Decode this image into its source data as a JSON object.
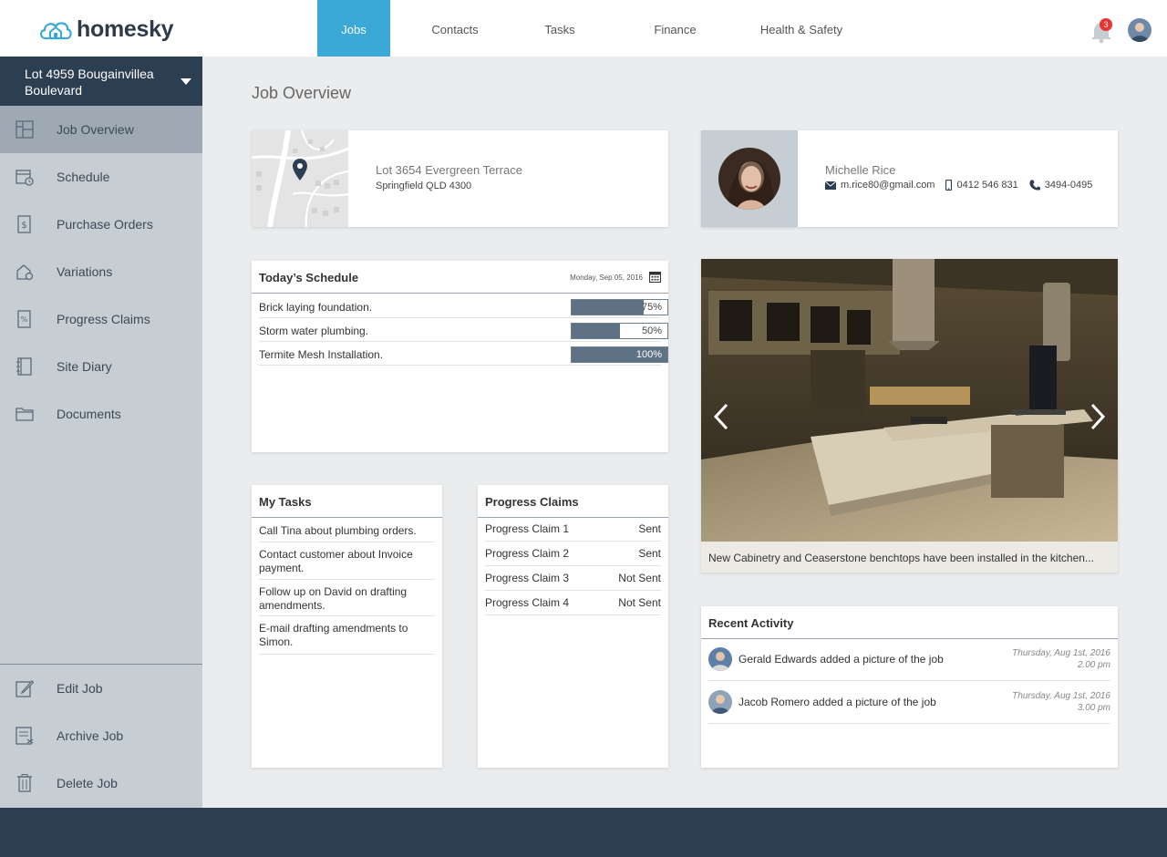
{
  "brand": {
    "name": "homesky",
    "accent": "#3aa9d8",
    "dark": "#2c3e52"
  },
  "nav": {
    "items": [
      {
        "label": "Jobs",
        "active": true
      },
      {
        "label": "Contacts",
        "active": false
      },
      {
        "label": "Tasks",
        "active": false
      },
      {
        "label": "Finance",
        "active": false
      },
      {
        "label": "Health & Safety",
        "active": false
      }
    ],
    "notifications": "3"
  },
  "sidebar": {
    "job_selector": "Lot 4959 Bougainvillea Boulevard",
    "items": [
      {
        "label": "Job Overview",
        "icon": "grid-icon",
        "active": true
      },
      {
        "label": "Schedule",
        "icon": "schedule-icon"
      },
      {
        "label": "Purchase Orders",
        "icon": "purchase-order-icon"
      },
      {
        "label": "Variations",
        "icon": "variations-icon"
      },
      {
        "label": "Progress Claims",
        "icon": "progress-claims-icon"
      },
      {
        "label": "Site Diary",
        "icon": "diary-icon"
      },
      {
        "label": "Documents",
        "icon": "folder-icon"
      }
    ],
    "actions": [
      {
        "label": "Edit Job",
        "icon": "edit-icon"
      },
      {
        "label": "Archive Job",
        "icon": "archive-icon"
      },
      {
        "label": "Delete Job",
        "icon": "trash-icon"
      }
    ]
  },
  "main": {
    "title": "Job Overview",
    "address": {
      "line1": "Lot 3654 Evergreen Terrace",
      "line2": "Springfield QLD 4300"
    },
    "contact": {
      "name": "Michelle Rice",
      "email": "m.rice80@gmail.com",
      "mobile": "0412 546 831",
      "phone": "3494-0495"
    },
    "schedule": {
      "title": "Today’s Schedule",
      "date": "Monday, Sep 05, 2016",
      "rows": [
        {
          "label": "Brick laying foundation.",
          "pct_text": "75%",
          "progress": 0.75
        },
        {
          "label": "Storm water plumbing.",
          "pct_text": "50%",
          "progress": 0.5
        },
        {
          "label": "Termite Mesh Installation.",
          "pct_text": "100%",
          "progress": 1.0
        }
      ]
    },
    "tasks": {
      "title": "My Tasks",
      "items": [
        "Call Tina about plumbing orders.",
        "Contact customer about Invoice payment.",
        "Follow up on David on drafting amendments.",
        "E-mail drafting amendments to Simon."
      ]
    },
    "claims": {
      "title": "Progress Claims",
      "rows": [
        {
          "name": "Progress Claim 1",
          "status": "Sent"
        },
        {
          "name": "Progress Claim 2",
          "status": "Sent"
        },
        {
          "name": "Progress Claim 3",
          "status": "Not Sent"
        },
        {
          "name": "Progress Claim 4",
          "status": "Not Sent"
        }
      ]
    },
    "photo": {
      "caption": "New Cabinetry and Ceaserstone benchtops have been installed in the kitchen..."
    },
    "activity": {
      "title": "Recent Activity",
      "rows": [
        {
          "text": "Gerald Edwards added a picture of the job",
          "date": "Thursday, Aug 1st, 2016",
          "time": "2.00 pm"
        },
        {
          "text": "Jacob Romero added a picture of the job",
          "date": "Thursday, Aug 1st, 2016",
          "time": "3.00 pm"
        }
      ]
    }
  }
}
